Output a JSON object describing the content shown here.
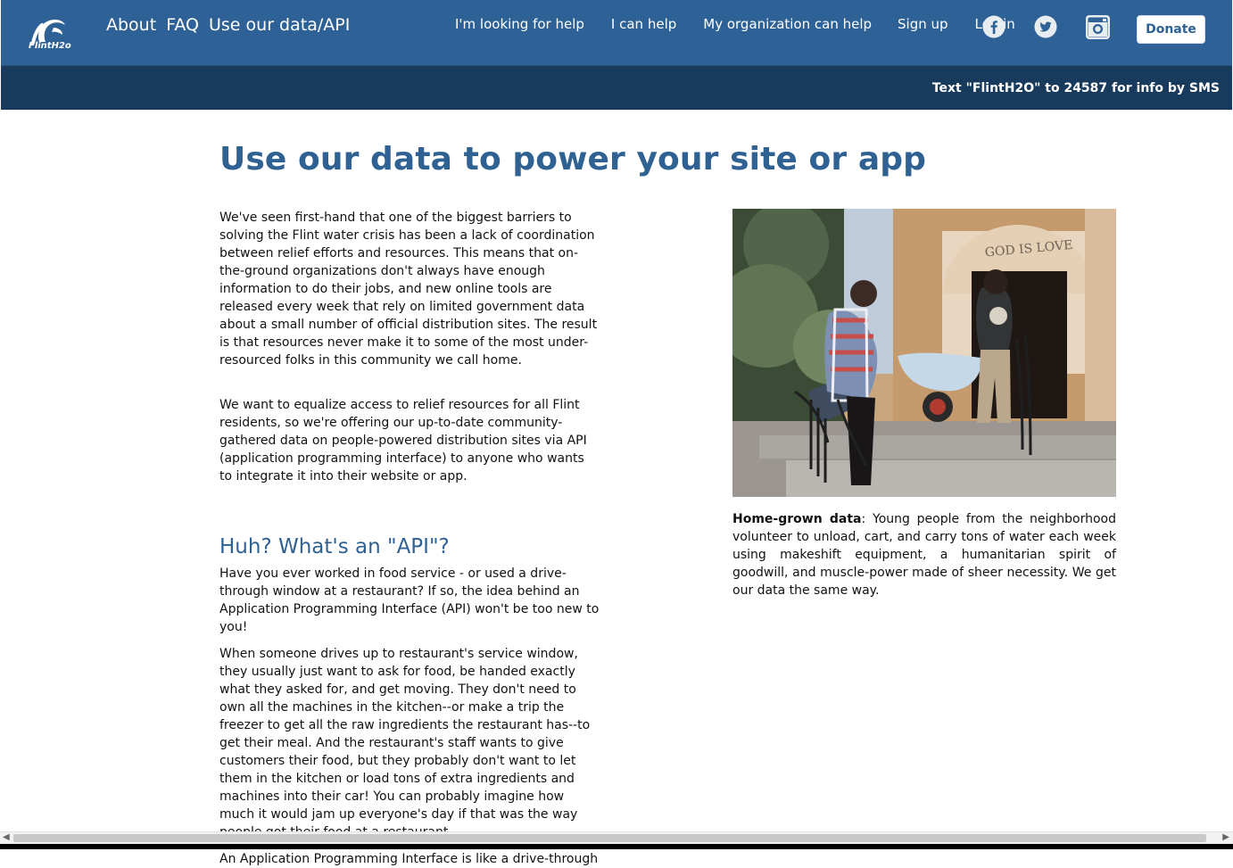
{
  "brand": {
    "logo_text": "FlintH2o"
  },
  "nav": {
    "left": [
      {
        "label": "About"
      },
      {
        "label": "FAQ"
      },
      {
        "label": "Use our data/API"
      }
    ],
    "right": [
      {
        "label": "I'm looking for help"
      },
      {
        "label": "I can help"
      },
      {
        "label": "My organization can help"
      },
      {
        "label": "Sign up"
      },
      {
        "label": "Log in"
      }
    ],
    "social": [
      "facebook-icon",
      "twitter-icon",
      "instagram-icon"
    ],
    "donate": "Donate"
  },
  "sms_text": "Text \"FlintH2O\" to 24587 for info by SMS",
  "main": {
    "title": "Use our data to power your site or app",
    "p1": "We've seen first-hand that one of the biggest barriers to solving the Flint water crisis has been a lack of coordination between relief efforts and resources. This means that on-the-ground organizations don't always have enough information to do their jobs, and new online tools are released every week that rely on limited government data about a small number of official distribution sites. The result is that resources never make it to some of the most under-resourced folks in this community we call home.",
    "p2": "We want to equalize access to relief resources for all Flint residents, so we're offering our up-to-date community-gathered data on people-powered distribution sites via API (application programming interface) to anyone who wants to integrate it into their website or app.",
    "subtitle": "Huh? What's an \"API\"?",
    "p3": "Have you ever worked in food service - or used a drive-through window at a restaurant? If so, the idea behind an Application Programming Interface (API) won't be too new to you!",
    "p4": "When someone drives up to restaurant's service window, they usually just want to ask for food, be handed exactly what they asked for, and get moving. They don't need to own all the machines in the kitchen--or make a trip the freezer to get all the raw ingredients the restaurant has--to get their meal. And the restaurant's staff wants to give customers their food, but they probably don't want to let them in the kitchen or load tons of extra ingredients and machines into their car! You can probably imagine how much it would jam up everyone's day if that was the way people got their food at a restaurant.",
    "p5": "An Application Programming Interface is like a drive-through"
  },
  "photo": {
    "sign_text": "GOD IS LOVE"
  },
  "caption": {
    "bold": "Home-grown data",
    "text": ": Young people from the neighborhood volunteer to unload, cart, and carry tons of water each week using makeshift equipment, a humanitarian spirit of goodwill, and muscle-power made of sheer necessity. We get our data the same way."
  },
  "scrollbar": {
    "left_arrow": "◀",
    "right_arrow": "▶"
  }
}
